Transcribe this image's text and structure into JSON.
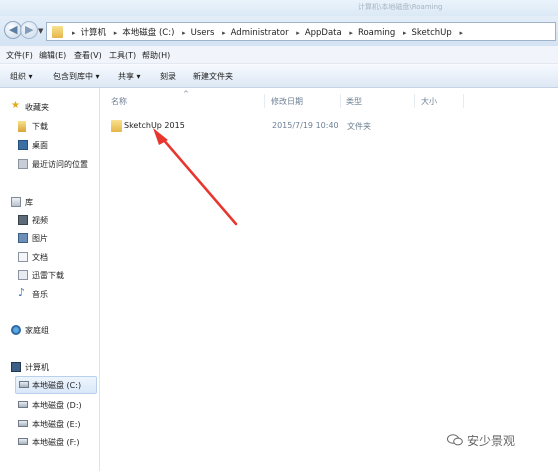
{
  "window": {
    "title_faint": "计算机\\本地磁盘\\Roaming"
  },
  "nav_buttons": {
    "back": "◀",
    "forward": "▶",
    "history_drop": "▼"
  },
  "address": {
    "crumbs": [
      "计算机",
      "本地磁盘 (C:)",
      "Users",
      "Administrator",
      "AppData",
      "Roaming",
      "SketchUp"
    ],
    "sep": "▸"
  },
  "menu": [
    "文件(F)",
    "编辑(E)",
    "查看(V)",
    "工具(T)",
    "帮助(H)"
  ],
  "toolbar": [
    "组织 ▾",
    "包含到库中 ▾",
    "共享 ▾",
    "刻录",
    "新建文件夹"
  ],
  "nav": {
    "favorites": {
      "label": "收藏夹",
      "items": [
        "下载",
        "桌面",
        "最近访问的位置"
      ]
    },
    "libraries": {
      "label": "库",
      "items": [
        "视频",
        "图片",
        "文档",
        "迅雷下载",
        "音乐"
      ]
    },
    "homegroup": {
      "label": "家庭组"
    },
    "computer": {
      "label": "计算机",
      "items": [
        "本地磁盘 (C:)",
        "本地磁盘 (D:)",
        "本地磁盘 (E:)",
        "本地磁盘 (F:)"
      ]
    }
  },
  "columns": {
    "name": "名称",
    "modified": "修改日期",
    "type": "类型",
    "size": "大小",
    "sort_indicator": "^"
  },
  "files": [
    {
      "name": "SketchUp 2015",
      "modified": "2015/7/19 10:40",
      "type": "文件夹",
      "size": ""
    }
  ],
  "colors": {
    "arrow": "#e8362f",
    "selection": "#d9e8f9"
  },
  "watermark": {
    "text": "安少景观",
    "icon": "wechat-icon"
  }
}
